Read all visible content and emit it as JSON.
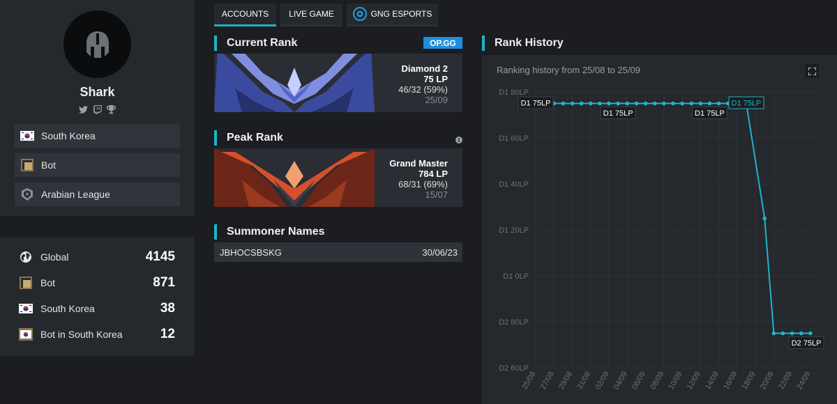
{
  "profile": {
    "name": "Shark",
    "social": [
      "twitter-icon",
      "twitch-icon",
      "trophy-icon"
    ],
    "info": [
      {
        "icon": "south-korea-flag-icon",
        "label": "South Korea"
      },
      {
        "icon": "bot-role-icon",
        "label": "Bot"
      },
      {
        "icon": "arabian-league-icon",
        "label": "Arabian League"
      }
    ]
  },
  "stats": [
    {
      "icon": "globe-icon",
      "label": "Global",
      "value": "4145"
    },
    {
      "icon": "bot-role-icon",
      "label": "Bot",
      "value": "871"
    },
    {
      "icon": "south-korea-flag-icon",
      "label": "South Korea",
      "value": "38"
    },
    {
      "icon": "south-korea-flag-bot-icon",
      "label": "Bot in South Korea",
      "value": "12"
    }
  ],
  "tabs": [
    {
      "label": "ACCOUNTS",
      "active": true
    },
    {
      "label": "LIVE GAME",
      "active": false
    },
    {
      "label": "GNG ESPORTS",
      "active": false
    }
  ],
  "current_rank": {
    "title": "Current Rank",
    "badge": "OP.GG",
    "tier": "Diamond 2",
    "lp": "75 LP",
    "record": "46/32 (59%)",
    "date": "25/09",
    "accent": "#6f7fd8"
  },
  "peak_rank": {
    "title": "Peak Rank",
    "tier": "Grand Master",
    "lp": "784 LP",
    "record": "68/31 (69%)",
    "date": "15/07",
    "accent": "#e0552a"
  },
  "summoner_names": {
    "title": "Summoner Names",
    "rows": [
      {
        "name": "JBHOCSBSKG",
        "date": "30/06/23"
      }
    ]
  },
  "rank_history": {
    "title": "Rank History",
    "subtitle": "Ranking history from 25/08 to 25/09"
  },
  "chart_data": {
    "type": "line",
    "color": "#1fb5c8",
    "yticks": [
      "D1 80LP",
      "D1 60LP",
      "D1 40LP",
      "D1 20LP",
      "D1 0LP",
      "D2 80LP",
      "D2 60LP"
    ],
    "ytick_values": [
      180,
      160,
      140,
      120,
      100,
      80,
      60
    ],
    "ylim": [
      60,
      180
    ],
    "xticks": [
      "25/08",
      "27/08",
      "29/08",
      "31/08",
      "02/09",
      "04/09",
      "06/09",
      "08/09",
      "10/09",
      "12/09",
      "14/09",
      "16/09",
      "18/09",
      "20/09",
      "22/09",
      "24/09"
    ],
    "x": [
      "25/08",
      "26/08",
      "27/08",
      "28/08",
      "29/08",
      "30/08",
      "31/08",
      "01/09",
      "02/09",
      "03/09",
      "04/09",
      "05/09",
      "06/09",
      "07/09",
      "08/09",
      "09/09",
      "10/09",
      "11/09",
      "12/09",
      "13/09",
      "14/09",
      "15/09",
      "16/09",
      "17/09",
      "18/09",
      "19/09",
      "20/09",
      "21/09",
      "22/09",
      "23/09",
      "24/09",
      "25/09"
    ],
    "values": [
      175,
      175,
      175,
      175,
      175,
      175,
      175,
      175,
      175,
      175,
      175,
      175,
      175,
      175,
      175,
      175,
      175,
      175,
      175,
      175,
      175,
      175,
      175,
      175,
      null,
      125,
      75,
      75,
      75,
      75,
      75,
      null
    ],
    "annotations": [
      {
        "label": "D1 75LP",
        "index": 0
      },
      {
        "label": "D1 75LP",
        "index": 9
      },
      {
        "label": "D1 75LP",
        "index": 19
      },
      {
        "label": "D1 75LP",
        "index": 23
      },
      {
        "label": "D2 75LP",
        "index": 30
      }
    ],
    "grid": true
  }
}
